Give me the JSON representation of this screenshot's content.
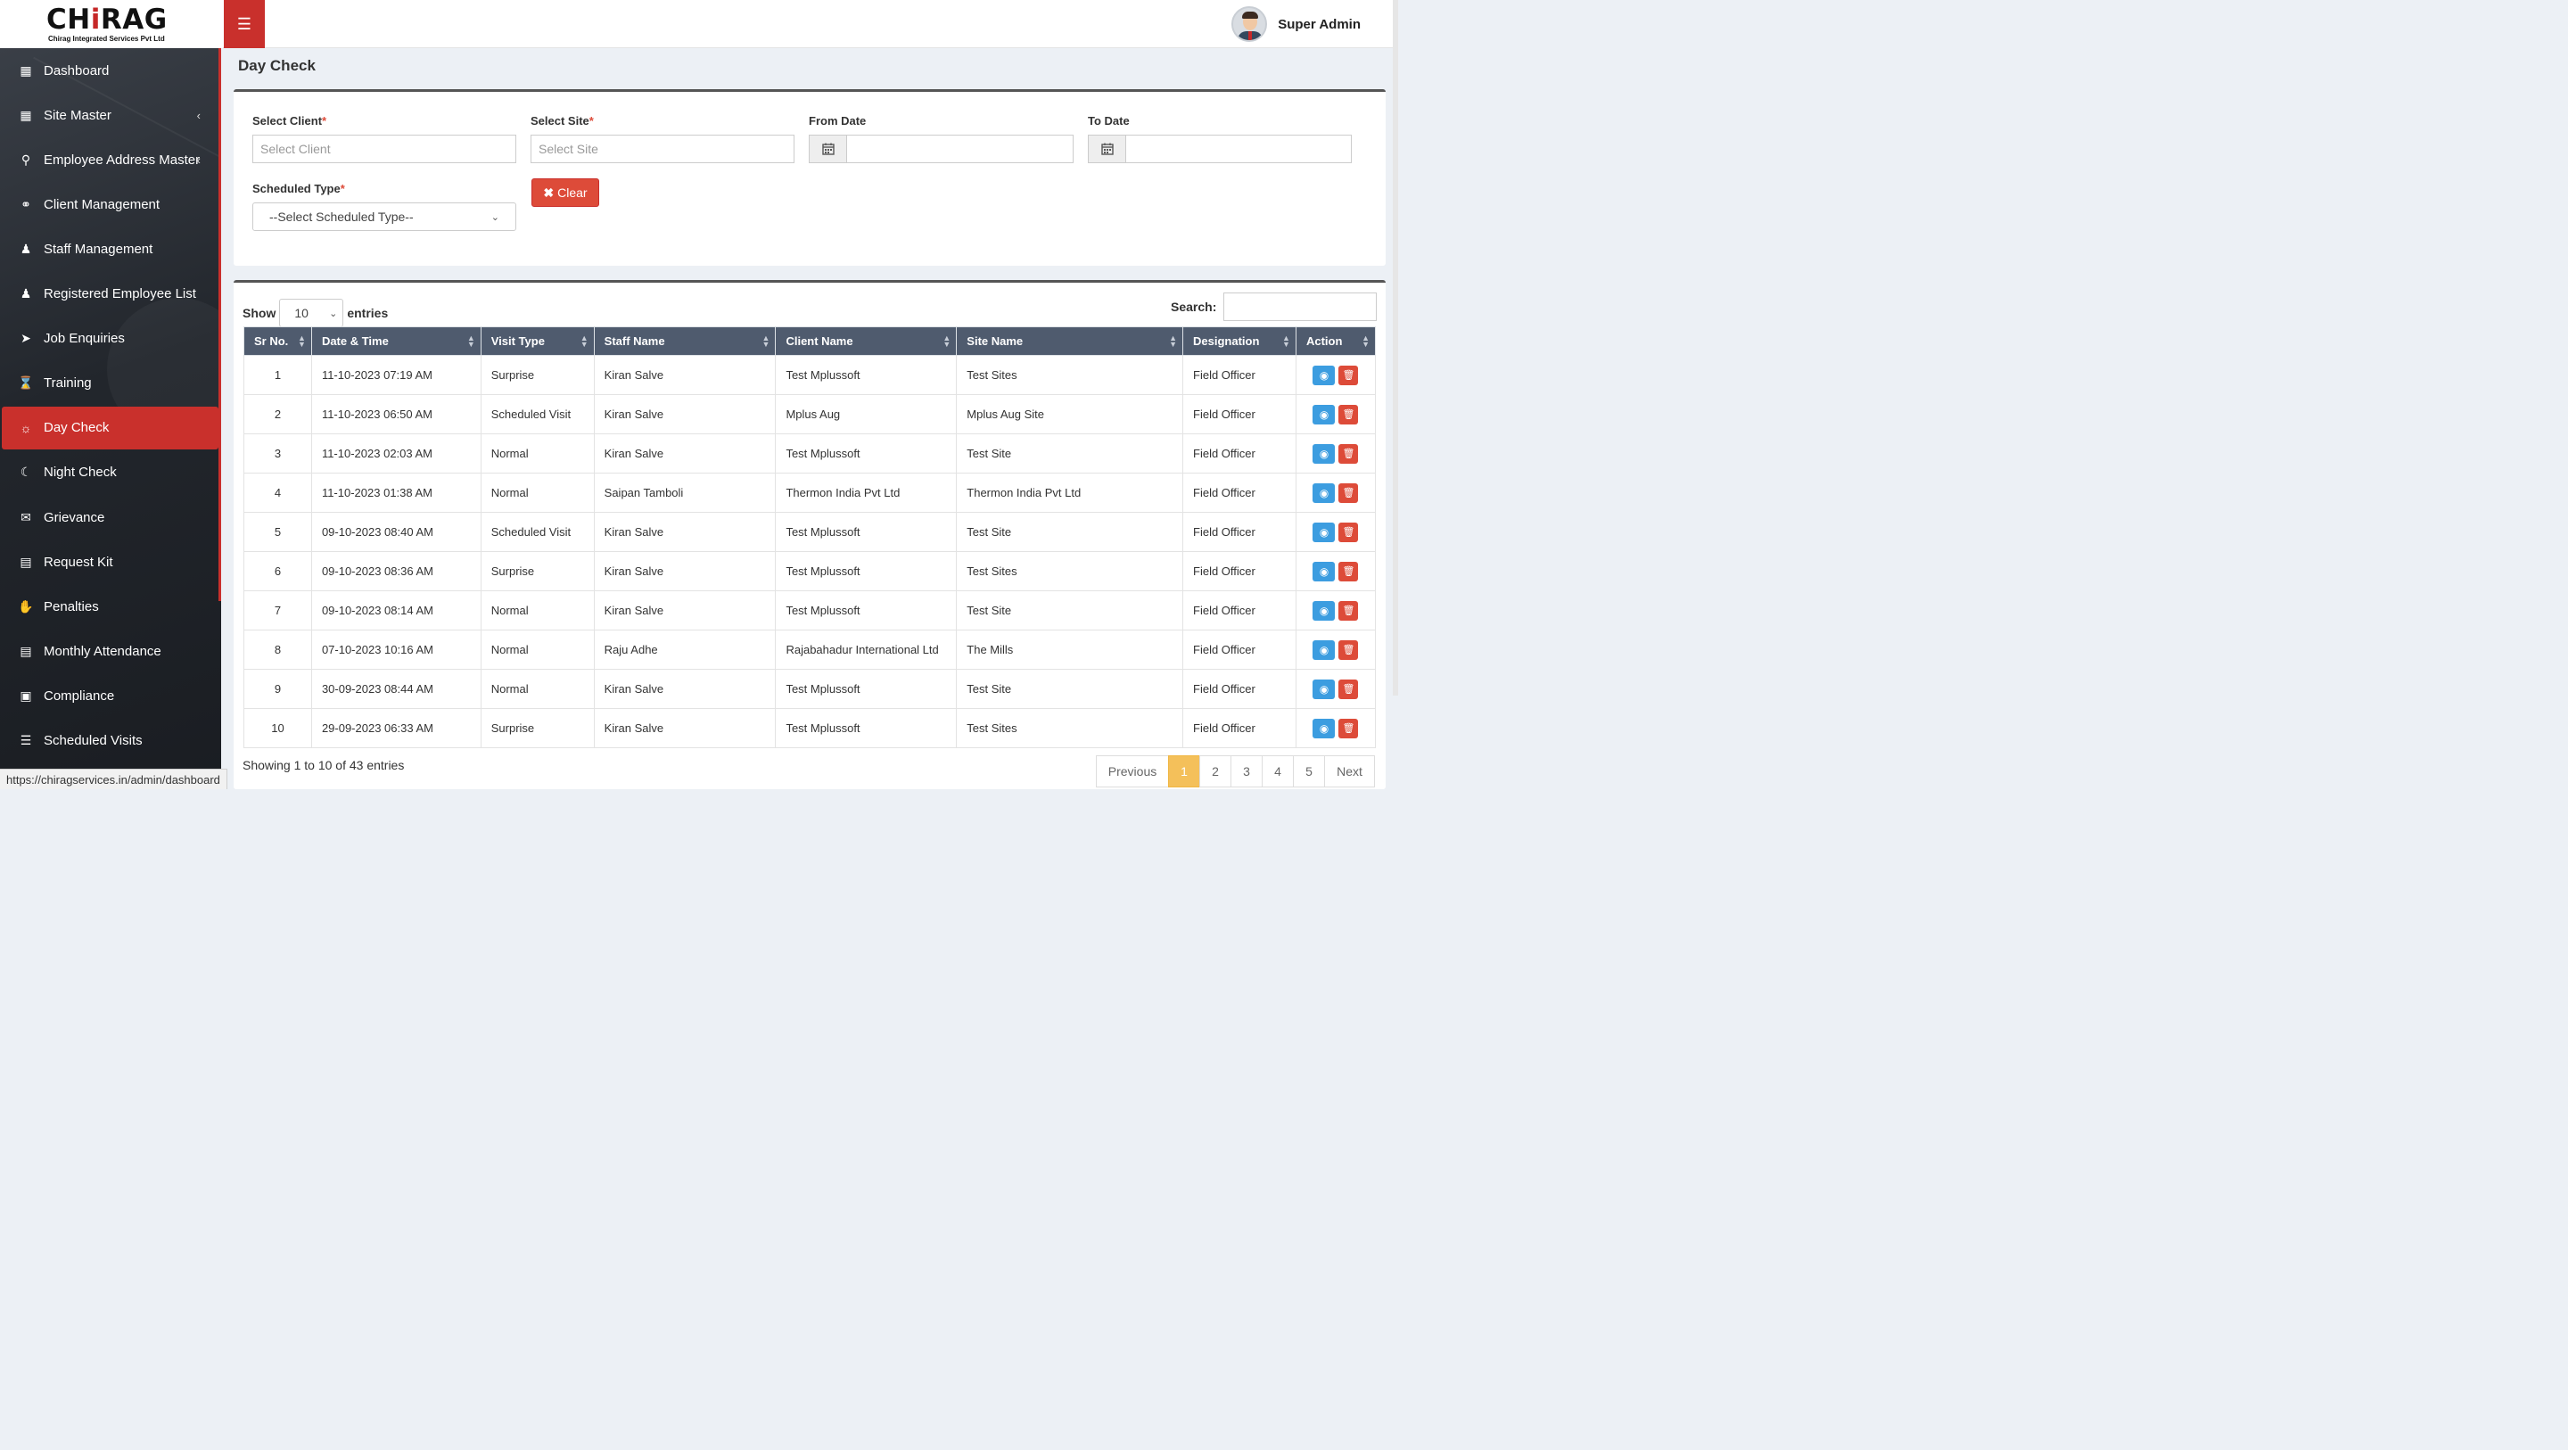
{
  "brand": {
    "name_part1": "CH",
    "name_accent": "i",
    "name_part2": "RAG",
    "tagline": "Chirag Integrated Services Pvt Ltd"
  },
  "header": {
    "menu_icon": "hamburger-icon",
    "user_name": "Super Admin"
  },
  "sidebar": {
    "items": [
      {
        "label": "Dashboard",
        "icon": "dashboard-icon"
      },
      {
        "label": "Site Master",
        "icon": "table-icon",
        "has_submenu": true
      },
      {
        "label": "Employee Address Master",
        "icon": "map-marker-icon",
        "has_submenu": true
      },
      {
        "label": "Client Management",
        "icon": "handshake-icon"
      },
      {
        "label": "Staff Management",
        "icon": "users-icon"
      },
      {
        "label": "Registered Employee List",
        "icon": "user-icon"
      },
      {
        "label": "Job Enquiries",
        "icon": "paper-plane-icon"
      },
      {
        "label": "Training",
        "icon": "hourglass-icon"
      },
      {
        "label": "Day Check",
        "icon": "sun-icon",
        "active": true
      },
      {
        "label": "Night Check",
        "icon": "moon-icon"
      },
      {
        "label": "Grievance",
        "icon": "comments-icon"
      },
      {
        "label": "Request Kit",
        "icon": "list-alt-icon"
      },
      {
        "label": "Penalties",
        "icon": "hand-icon"
      },
      {
        "label": "Monthly Attendance",
        "icon": "file-text-icon"
      },
      {
        "label": "Compliance",
        "icon": "file-icon"
      },
      {
        "label": "Scheduled Visits",
        "icon": "list-icon"
      }
    ]
  },
  "page": {
    "title": "Day Check"
  },
  "filters": {
    "client_label": "Select Client",
    "client_placeholder": "Select Client",
    "site_label": "Select Site",
    "site_placeholder": "Select Site",
    "from_date_label": "From Date",
    "to_date_label": "To Date",
    "scheduled_type_label": "Scheduled Type",
    "scheduled_type_value": "--Select Scheduled Type--",
    "required_mark": "*",
    "clear_label": "Clear"
  },
  "table": {
    "show_label": "Show",
    "page_length": "10",
    "entries_label": "entries",
    "search_label": "Search:",
    "columns": [
      "Sr No.",
      "Date & Time",
      "Visit Type",
      "Staff Name",
      "Client Name",
      "Site Name",
      "Designation",
      "Action"
    ],
    "rows": [
      [
        "1",
        "11-10-2023 07:19 AM",
        "Surprise",
        "Kiran Salve",
        "Test Mplussoft",
        "Test Sites",
        "Field Officer"
      ],
      [
        "2",
        "11-10-2023 06:50 AM",
        "Scheduled Visit",
        "Kiran Salve",
        "Mplus Aug",
        "Mplus Aug Site",
        "Field Officer"
      ],
      [
        "3",
        "11-10-2023 02:03 AM",
        "Normal",
        "Kiran Salve",
        "Test Mplussoft",
        "Test Site",
        "Field Officer"
      ],
      [
        "4",
        "11-10-2023 01:38 AM",
        "Normal",
        "Saipan Tamboli",
        "Thermon India Pvt Ltd",
        "Thermon India Pvt Ltd",
        "Field Officer"
      ],
      [
        "5",
        "09-10-2023 08:40 AM",
        "Scheduled Visit",
        "Kiran Salve",
        "Test Mplussoft",
        "Test Site",
        "Field Officer"
      ],
      [
        "6",
        "09-10-2023 08:36 AM",
        "Surprise",
        "Kiran Salve",
        "Test Mplussoft",
        "Test Sites",
        "Field Officer"
      ],
      [
        "7",
        "09-10-2023 08:14 AM",
        "Normal",
        "Kiran Salve",
        "Test Mplussoft",
        "Test Site",
        "Field Officer"
      ],
      [
        "8",
        "07-10-2023 10:16 AM",
        "Normal",
        "Raju Adhe",
        "Rajabahadur International Ltd",
        "The Mills",
        "Field Officer"
      ],
      [
        "9",
        "30-09-2023 08:44 AM",
        "Normal",
        "Kiran Salve",
        "Test Mplussoft",
        "Test Site",
        "Field Officer"
      ],
      [
        "10",
        "29-09-2023 06:33 AM",
        "Surprise",
        "Kiran Salve",
        "Test Mplussoft",
        "Test Sites",
        "Field Officer"
      ]
    ],
    "info": "Showing 1 to 10 of 43 entries",
    "pagination": {
      "previous": "Previous",
      "pages": [
        "1",
        "2",
        "3",
        "4",
        "5"
      ],
      "current": "1",
      "next": "Next"
    }
  },
  "status_url": "https://chiragservices.in/admin/dashboard",
  "colors": {
    "accent_red": "#c9302c",
    "header_blue_gray": "#4f5b6e",
    "view_blue": "#3c9de0",
    "pager_active": "#f4c05a"
  }
}
